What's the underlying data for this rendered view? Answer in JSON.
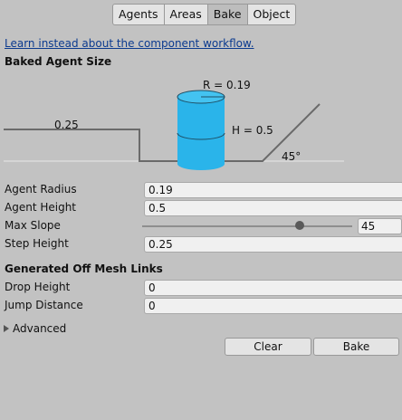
{
  "tabs": [
    {
      "label": "Agents",
      "active": false
    },
    {
      "label": "Areas",
      "active": false
    },
    {
      "label": "Bake",
      "active": true
    },
    {
      "label": "Object",
      "active": false
    }
  ],
  "link_text": "Learn instead about the component workflow.",
  "baked_agent_size": {
    "title": "Baked Agent Size",
    "diagram": {
      "step_label": "0.25",
      "radius_label": "R = 0.19",
      "height_label": "H = 0.5",
      "slope_label": "45°",
      "cylinder_color": "#2ab4ea"
    }
  },
  "fields": {
    "agent_radius": {
      "label": "Agent Radius",
      "value": "0.19"
    },
    "agent_height": {
      "label": "Agent Height",
      "value": "0.5"
    },
    "max_slope": {
      "label": "Max Slope",
      "value": "45",
      "fraction": 0.75
    },
    "step_height": {
      "label": "Step Height",
      "value": "0.25"
    }
  },
  "off_mesh": {
    "title": "Generated Off Mesh Links",
    "drop_height": {
      "label": "Drop Height",
      "value": "0"
    },
    "jump_distance": {
      "label": "Jump Distance",
      "value": "0"
    }
  },
  "advanced_label": "Advanced",
  "buttons": {
    "clear": "Clear",
    "bake": "Bake"
  }
}
